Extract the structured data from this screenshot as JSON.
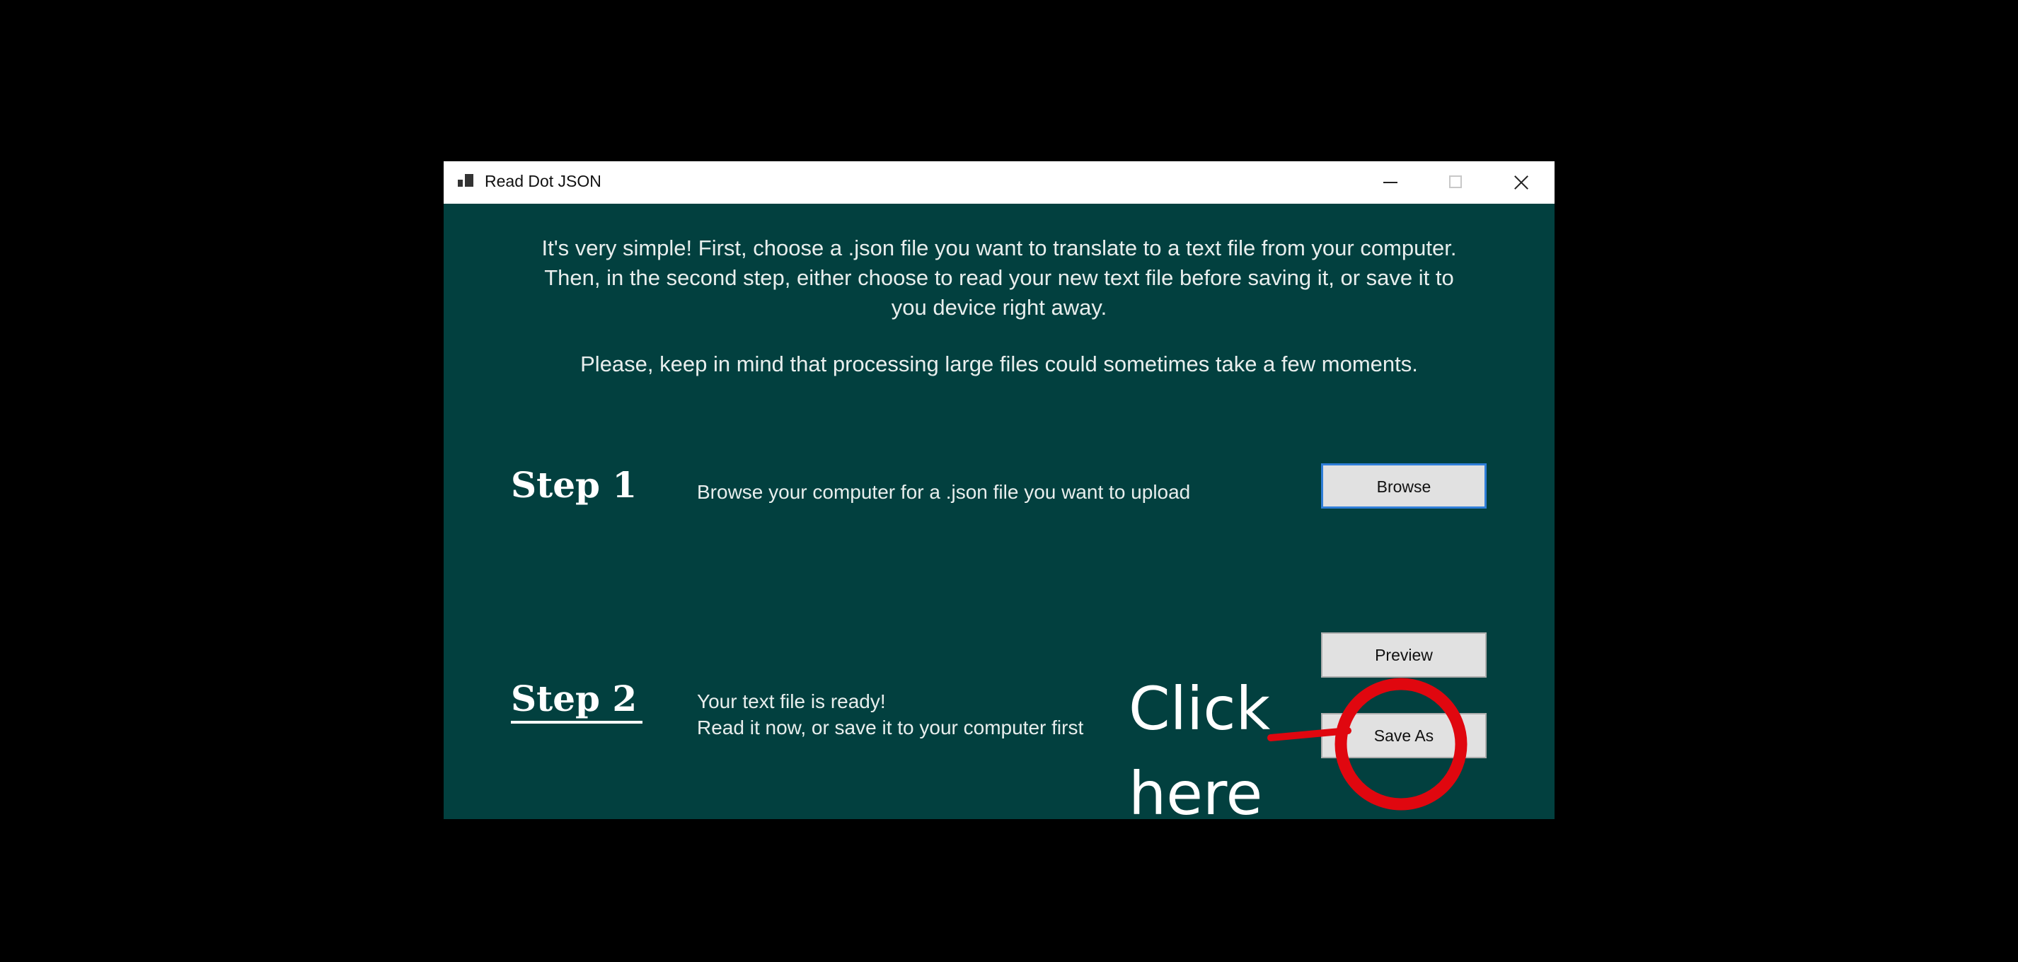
{
  "window": {
    "title": "Read Dot JSON",
    "icons": {
      "app": "app-icon",
      "minimize": "minimize-icon",
      "maximize": "maximize-icon",
      "close": "close-icon"
    }
  },
  "intro": {
    "line1": "It's very simple! First, choose a .json file you want to translate to a text file from your computer.",
    "line2": "Then, in the second step, either choose to read your new text file before saving it, or save it to",
    "line3": "you device right away.",
    "note": "Please, keep in mind that processing large files could sometimes take a few moments."
  },
  "step1": {
    "title": "Step 1",
    "description": "Browse your computer for a .json file you want to upload",
    "browse_label": "Browse"
  },
  "step2": {
    "title": "Step 2",
    "description_line1": "Your text file is ready!",
    "description_line2": "Read it now, or save it to your computer first",
    "preview_label": "Preview",
    "save_as_label": "Save As"
  },
  "annotation": {
    "line1": "Click",
    "line2": "here",
    "color": "#e0070f"
  },
  "colors": {
    "window_background": "#02403f",
    "page_background": "#000000",
    "button_focus": "#2f7ed8"
  }
}
